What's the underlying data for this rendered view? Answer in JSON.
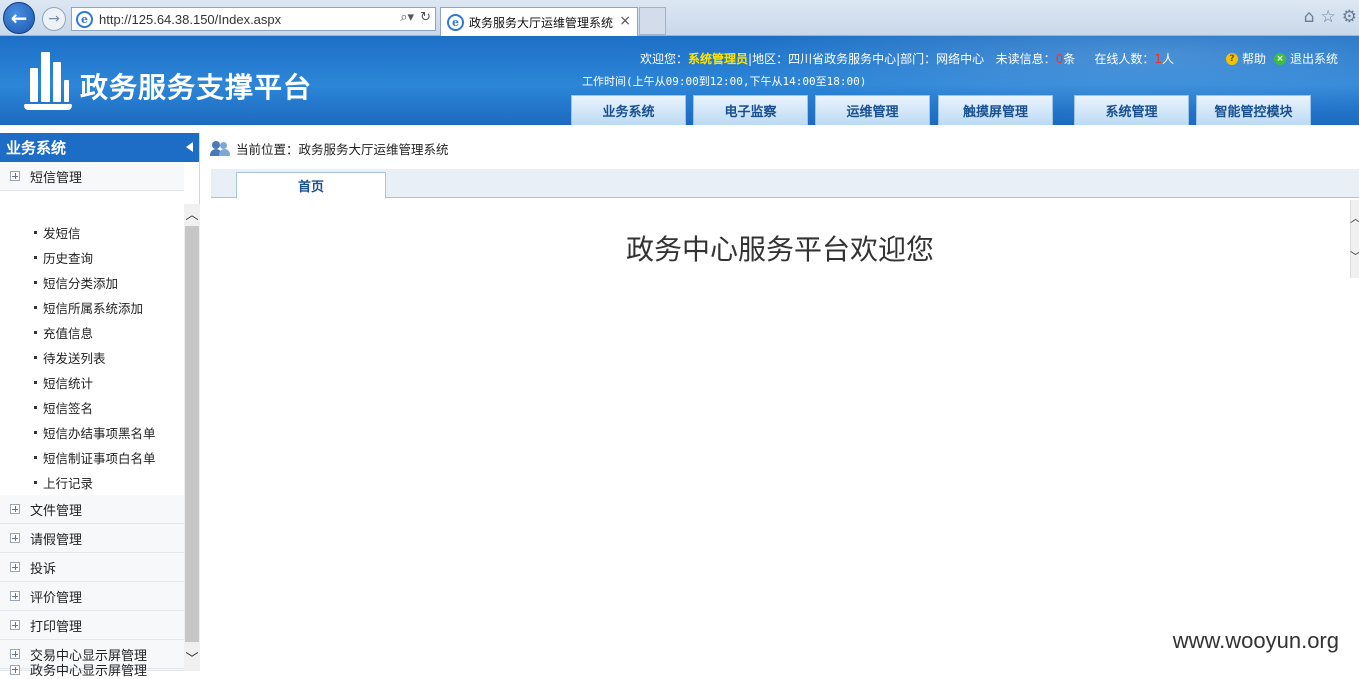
{
  "browser": {
    "url": "http://125.64.38.150/Index.aspx",
    "tab_title": "政务服务大厅运维管理系统",
    "tab_close": "×"
  },
  "header": {
    "app_title": "政务服务支撑平台",
    "welcome_prefix": "欢迎您：",
    "user_name": "系统管理员",
    "region_text": "|地区：四川省政务服务中心|部门：网络中心",
    "unread_label": "未读信息：",
    "unread_count": "0",
    "unread_suffix": "条",
    "online_label": "在线人数：",
    "online_count": "1",
    "online_suffix": "人",
    "help": "帮助",
    "logout": "退出系统",
    "work_hours": "工作时间(上午从09:00到12:00,下午从14:00至18:00)",
    "tabs": [
      "业务系统",
      "电子监察",
      "运维管理",
      "触摸屏管理",
      "系统管理",
      "智能管控模块"
    ]
  },
  "sidebar": {
    "title": "业务系统",
    "groups_top": [
      "短信管理"
    ],
    "sub_items": [
      "发短信",
      "历史查询",
      "短信分类添加",
      "短信所属系统添加",
      "充值信息",
      "待发送列表",
      "短信统计",
      "短信签名",
      "短信办结事项黑名单",
      "短信制证事项白名单",
      "上行记录"
    ],
    "groups": [
      "文件管理",
      "请假管理",
      "投诉",
      "评价管理",
      "打印管理",
      "交易中心显示屏管理",
      "政务中心显示屏管理"
    ]
  },
  "main": {
    "breadcrumb": "当前位置：政务服务大厅运维管理系统",
    "home_tab": "首页",
    "welcome_text": "政务中心服务平台欢迎您"
  },
  "watermark": "www.wooyun.org",
  "colors": {
    "header_blue": "#1c6fc5",
    "sidebar_header": "#1d6cc6",
    "highlight_yellow": "#ffe300",
    "alert_red": "#e8352e"
  }
}
